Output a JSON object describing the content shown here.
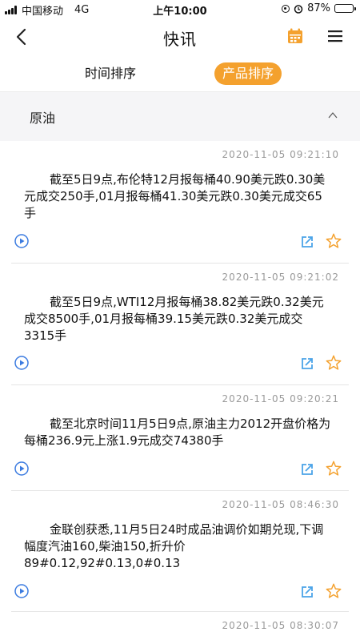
{
  "status_bar": {
    "carrier": "中国移动",
    "network": "4G",
    "time": "上午10:00",
    "battery": "87%",
    "battery_level": 0.87
  },
  "header": {
    "title": "快讯",
    "back_icon": "back-arrow-icon",
    "calendar_icon": "calendar-icon",
    "menu_icon": "hamburger-menu-icon"
  },
  "tabs": [
    {
      "label": "时间排序",
      "active": false
    },
    {
      "label": "产品排序",
      "active": true
    }
  ],
  "category": {
    "label": "原油",
    "toggle_icon": "chevron-up-icon"
  },
  "news": [
    {
      "time": "2020-11-05 09:21:10",
      "content": "截至5日9点,布伦特12月报每桶40.90美元跌0.30美元成交250手,01月报每桶41.30美元跌0.30美元成交65手"
    },
    {
      "time": "2020-11-05 09:21:02",
      "content": "截至5日9点,WTI12月报每桶38.82美元跌0.32美元成交8500手,01月报每桶39.15美元跌0.32美元成交3315手"
    },
    {
      "time": "2020-11-05 09:20:21",
      "content": "截至北京时间11月5日9点,原油主力2012开盘价格为每桶236.9元上涨1.9元成交74380手"
    },
    {
      "time": "2020-11-05 08:46:30",
      "content": "金联创获悉,11月5日24时成品油调价如期兑现,下调幅度汽油160,柴油150,折升价89#0.12,92#0.13,0#0.13"
    },
    {
      "time": "2020-11-05 08:30:07",
      "content": ""
    }
  ],
  "colors": {
    "accent": "#f4a12e",
    "play": "#3b7be0",
    "share": "#4aa3e8",
    "star": "#f4a12e"
  }
}
